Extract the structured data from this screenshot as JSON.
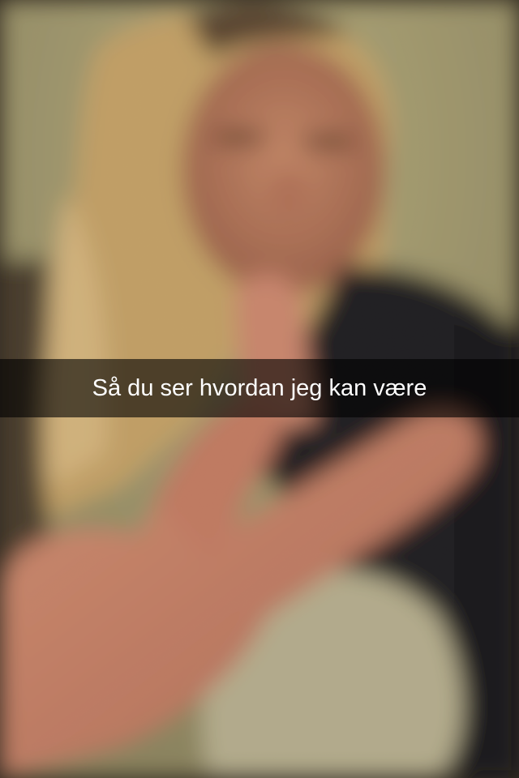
{
  "snap": {
    "caption": "Så du ser hvordan jeg kan være"
  },
  "colors": {
    "caption_text": "#ffffff",
    "caption_bar": "rgba(0,0,0,0.6)"
  }
}
